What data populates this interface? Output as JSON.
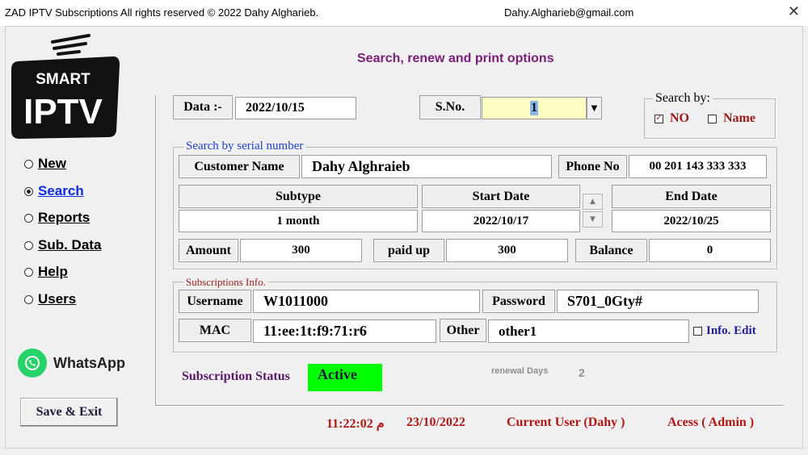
{
  "window": {
    "title": "ZAD IPTV Subscriptions All rights reserved © 2022 Dahy Algharieb.",
    "email": "Dahy.Algharieb@gmail.com",
    "close_glyph": "✕"
  },
  "logo": {
    "line1": "SMART",
    "line2": "IPTV"
  },
  "nav": {
    "items": [
      {
        "label": "New",
        "selected": false
      },
      {
        "label": "Search",
        "selected": true
      },
      {
        "label": "Reports",
        "selected": false
      },
      {
        "label": "Sub. Data",
        "selected": false
      },
      {
        "label": "Help",
        "selected": false
      },
      {
        "label": "Users",
        "selected": false
      }
    ]
  },
  "whatsapp": {
    "label": "WhatsApp"
  },
  "save_exit": {
    "label": "Save & Exit"
  },
  "heading": "Search, renew and print options",
  "top": {
    "date_label": "Data :-",
    "date_value": "2022/10/15",
    "sno_label": "S.No.",
    "sno_value": "1",
    "dropdown_glyph": "▼"
  },
  "search_by": {
    "legend": "Search by:",
    "no": {
      "label": "NO",
      "checked": true
    },
    "name": {
      "label": "Name",
      "checked": false
    }
  },
  "serial_group": {
    "legend": "Search by serial number",
    "customer_label": "Customer Name",
    "customer_value": "Dahy Alghraieb",
    "phone_label": "Phone No",
    "phone_value": "00 201 143 333 333",
    "subtype_label": "Subtype",
    "subtype_value": "1 month",
    "start_label": "Start Date",
    "start_value": "2022/10/17",
    "end_label": "End Date",
    "end_value": "2022/10/25",
    "spin_up": "▲",
    "spin_down": "▼",
    "amount_label": "Amount",
    "amount_value": "300",
    "paidup_label": "paid up",
    "paidup_value": "300",
    "balance_label": "Balance",
    "balance_value": "0"
  },
  "subs_group": {
    "legend": "Subscriptions Info.",
    "username_label": "Username",
    "username_value": "W1011000",
    "password_label": "Password",
    "password_value": "S701_0Gty#",
    "mac_label": "MAC",
    "mac_value": "11:ee:1t:f9:71:r6",
    "other_label": "Other",
    "other_value": "other1",
    "info_edit_label": "Info. Edit",
    "info_edit_checked": false
  },
  "status": {
    "label": "Subscription Status",
    "value": "Active",
    "renewal_label": "renewal Days",
    "renewal_value": "2"
  },
  "footer": {
    "time": "11:22:02 م",
    "date": "23/10/2022",
    "user": "Current User (Dahy )",
    "access": "Acess ( Admin )"
  },
  "colors": {
    "heading": "#7a1e78",
    "footer": "#b01818",
    "status_active": "#00ff00",
    "sno_highlight": "#ffffc4",
    "legend_blue": "#1c3fd0",
    "legend_red": "#9a1a1a",
    "search_by_red": "#9a1a1a",
    "info_edit_blue": "#1e1e9a",
    "status_label": "#5a1a6a"
  }
}
